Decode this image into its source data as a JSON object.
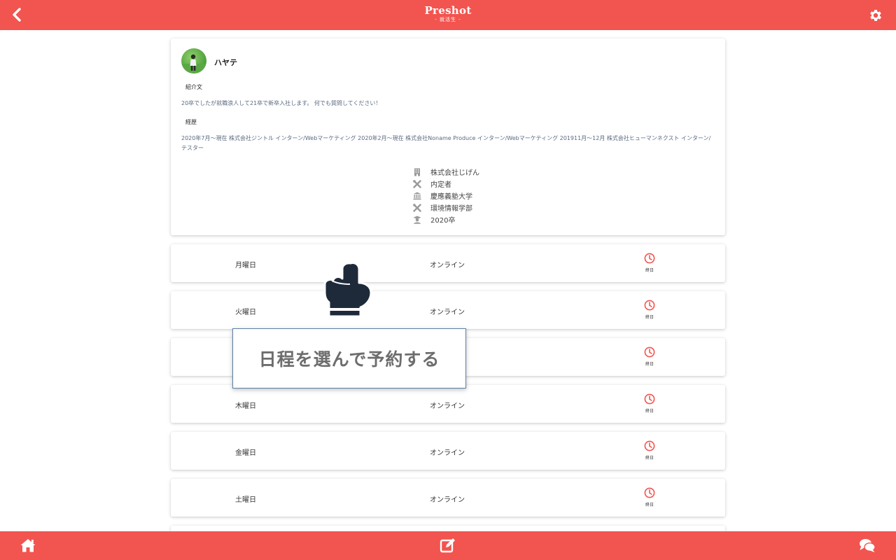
{
  "header": {
    "brand_name": "Preshot",
    "brand_sub": "- 就活生 -",
    "back_icon": "chevron-left-icon",
    "settings_icon": "gear-icon"
  },
  "profile": {
    "name": "ハヤテ",
    "intro_label": "紹介文",
    "intro_text": "20卒でしたが就職浪人して21卒で新卒入社します。 何でも質問してください！",
    "career_label": "経歴",
    "career_text": "2020年7月〜現在 株式会社ジントル インターン/Webマーケティング 2020年2月〜現在 株式会社Noname Produce インターン/Webマーケティング 201911月〜12月 株式会社ヒューマンネクスト インターン/テスター",
    "info": [
      {
        "icon": "building-icon",
        "text": "株式会社じげん"
      },
      {
        "icon": "tools-icon",
        "text": "内定者"
      },
      {
        "icon": "university-icon",
        "text": "慶應義塾大学"
      },
      {
        "icon": "tools-icon",
        "text": "環境情報学部"
      },
      {
        "icon": "graduate-icon",
        "text": "2020卒"
      }
    ]
  },
  "schedule": [
    {
      "day": "月曜日",
      "mode": "オンライン",
      "time": "終日"
    },
    {
      "day": "火曜日",
      "mode": "オンライン",
      "time": "終日"
    },
    {
      "day": "",
      "mode": "",
      "time": "終日"
    },
    {
      "day": "木曜日",
      "mode": "オンライン",
      "time": "終日"
    },
    {
      "day": "金曜日",
      "mode": "オンライン",
      "time": "終日"
    },
    {
      "day": "土曜日",
      "mode": "オンライン",
      "time": "終日"
    }
  ],
  "tooltip": {
    "text": "日程を選んで予約する",
    "icon": "pointing-hand-icon"
  },
  "bottom_nav": {
    "home_icon": "home-icon",
    "edit_icon": "edit-icon",
    "chat_icon": "chat-icon"
  },
  "colors": {
    "accent": "#f2544f",
    "icon_gray": "#9a9a9a",
    "hand_dark": "#1e2a3a"
  }
}
